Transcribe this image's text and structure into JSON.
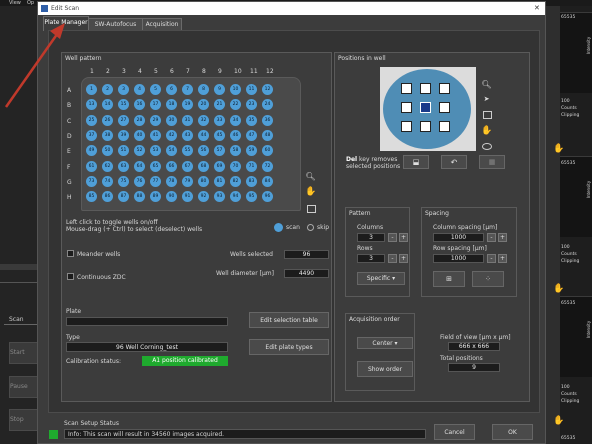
{
  "bg": {
    "menu": [
      "View",
      "Op"
    ],
    "left_tab": "Scan",
    "left_buttons": [
      "Start",
      "Pause",
      "Stop"
    ],
    "right": {
      "max_values": [
        "65535",
        "65535",
        "65535",
        "65535"
      ],
      "small_values": [
        "100",
        "100",
        "100"
      ],
      "labels": [
        "Intensity",
        "Counts",
        "Clipping"
      ]
    }
  },
  "dialog": {
    "title": "Edit Scan",
    "close": "✕",
    "tabs": [
      {
        "label": "Plate Manager",
        "active": true
      },
      {
        "label": "SW-Autofocus"
      },
      {
        "label": "Acquisition"
      }
    ]
  },
  "well_pattern": {
    "title": "Well pattern",
    "columns": [
      "1",
      "2",
      "3",
      "4",
      "5",
      "6",
      "7",
      "8",
      "9",
      "10",
      "11",
      "12"
    ],
    "rows": [
      "A",
      "B",
      "C",
      "D",
      "E",
      "F",
      "G",
      "H"
    ],
    "help1": "Left click to toggle wells on/off",
    "help2": "Mouse-drag (+ Ctrl) to select (deselect) wells",
    "mode_scan": "scan",
    "mode_skip": "skip",
    "meander_label": "Meander wells",
    "continuous_label": "Continuous ZDC",
    "wells_selected_label": "Wells selected",
    "wells_selected": "96",
    "well_diameter_label": "Well diameter [µm]",
    "well_diameter": "4490",
    "plate_label": "Plate",
    "type_label": "Type",
    "type_value": "96  Well Corning_test",
    "calibration_label": "Calibration status:",
    "calibration_value": "A1 position calibrated",
    "edit_selection": "Edit selection table",
    "edit_types": "Edit plate types"
  },
  "positions": {
    "title": "Positions in well",
    "del_key": "Del",
    "del_text1": "key removes",
    "del_text2": "selected positions",
    "pattern": {
      "title": "Pattern",
      "columns_label": "Columns",
      "columns": "3",
      "rows_label": "Rows",
      "rows": "3",
      "type": "Specific"
    },
    "spacing": {
      "title": "Spacing",
      "col_label": "Column spacing [µm]",
      "col": "1000",
      "row_label": "Row spacing [µm]",
      "row": "1000"
    },
    "acq": {
      "title": "Acquisition order",
      "order": "Center",
      "show": "Show order"
    },
    "fov_label": "Field of view [µm x µm]",
    "fov": "666 x 666",
    "total_label": "Total positions",
    "total": "9"
  },
  "footer": {
    "status_title": "Scan Setup Status",
    "status_text": "Info: This scan will result in 34560 images acquired.",
    "cancel": "Cancel",
    "ok": "OK"
  },
  "colors": {
    "accent": "#4f9fd8",
    "calibrated": "#1faa2e",
    "arrow": "#c0392b"
  }
}
